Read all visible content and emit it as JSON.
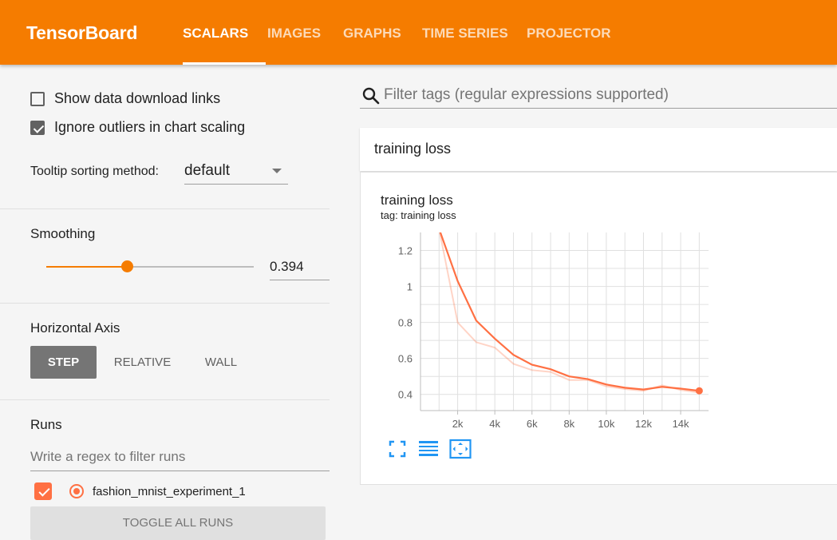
{
  "app": {
    "title": "TensorBoard"
  },
  "tabs": [
    {
      "label": "SCALARS",
      "active": true
    },
    {
      "label": "IMAGES",
      "active": false
    },
    {
      "label": "GRAPHS",
      "active": false
    },
    {
      "label": "TIME SERIES",
      "active": false
    },
    {
      "label": "PROJECTOR",
      "active": false
    }
  ],
  "sidebar": {
    "show_download_links": {
      "label": "Show data download links",
      "checked": false
    },
    "ignore_outliers": {
      "label": "Ignore outliers in chart scaling",
      "checked": true
    },
    "tooltip_sorting": {
      "label": "Tooltip sorting method:",
      "value": "default"
    },
    "smoothing": {
      "label": "Smoothing",
      "value": "0.394",
      "fraction": 0.394
    },
    "horizontal_axis": {
      "label": "Horizontal Axis",
      "options": [
        "STEP",
        "RELATIVE",
        "WALL"
      ],
      "selected": "STEP"
    },
    "runs": {
      "label": "Runs",
      "filter_placeholder": "Write a regex to filter runs",
      "items": [
        {
          "name": "fashion_mnist_experiment_1",
          "checked": true,
          "color": "#ff7043"
        }
      ],
      "toggle_label": "TOGGLE ALL RUNS"
    }
  },
  "main": {
    "filter_placeholder": "Filter tags (regular expressions supported)",
    "card": {
      "header": "training loss",
      "chart_title": "training loss",
      "tag": "tag: training loss"
    }
  },
  "colors": {
    "accent": "#f57c00",
    "series": "#ff7043",
    "button_gray": "#757575",
    "icon_blue": "#2196f3"
  },
  "icons": [
    "search-icon",
    "fit-domain-icon",
    "data-table-icon",
    "expand-chart-icon"
  ],
  "chart_data": {
    "type": "line",
    "title": "training loss",
    "xlabel": "",
    "ylabel": "",
    "xlim": [
      0,
      15500
    ],
    "ylim": [
      0.31,
      1.3
    ],
    "x_ticks": [
      "2k",
      "4k",
      "6k",
      "8k",
      "10k",
      "12k",
      "14k"
    ],
    "y_ticks": [
      "0.4",
      "0.6",
      "0.8",
      "1",
      "1.2"
    ],
    "grid": true,
    "series": [
      {
        "name": "fashion_mnist_experiment_1",
        "x": [
          1000,
          2000,
          3000,
          4000,
          5000,
          6000,
          7000,
          8000,
          9000,
          10000,
          11000,
          12000,
          13000,
          14000,
          15000
        ],
        "smoothed": [
          1.32,
          1.03,
          0.81,
          0.71,
          0.62,
          0.565,
          0.54,
          0.5,
          0.485,
          0.455,
          0.437,
          0.427,
          0.442,
          0.432,
          0.42
        ],
        "raw": [
          1.32,
          0.8,
          0.69,
          0.66,
          0.57,
          0.535,
          0.525,
          0.48,
          0.48,
          0.445,
          0.43,
          0.42,
          0.45,
          0.425,
          0.41
        ]
      }
    ]
  }
}
